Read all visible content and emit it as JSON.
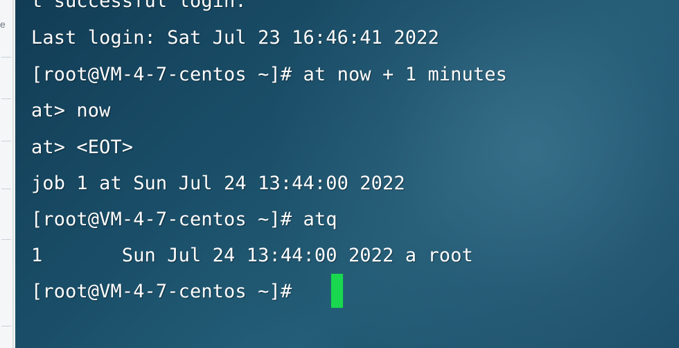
{
  "left_panel": {
    "cut_text": "e"
  },
  "terminal": {
    "lines": [
      "t successful login.",
      "Last login: Sat Jul 23 16:46:41 2022",
      "[root@VM-4-7-centos ~]# at now + 1 minutes",
      "at> now",
      "at> <EOT>",
      "job 1 at Sun Jul 24 13:44:00 2022",
      "[root@VM-4-7-centos ~]# atq",
      "1       Sun Jul 24 13:44:00 2022 a root",
      "[root@VM-4-7-centos ~]# "
    ],
    "cursor_color": "#19d84f",
    "text_color": "#ffffff"
  }
}
